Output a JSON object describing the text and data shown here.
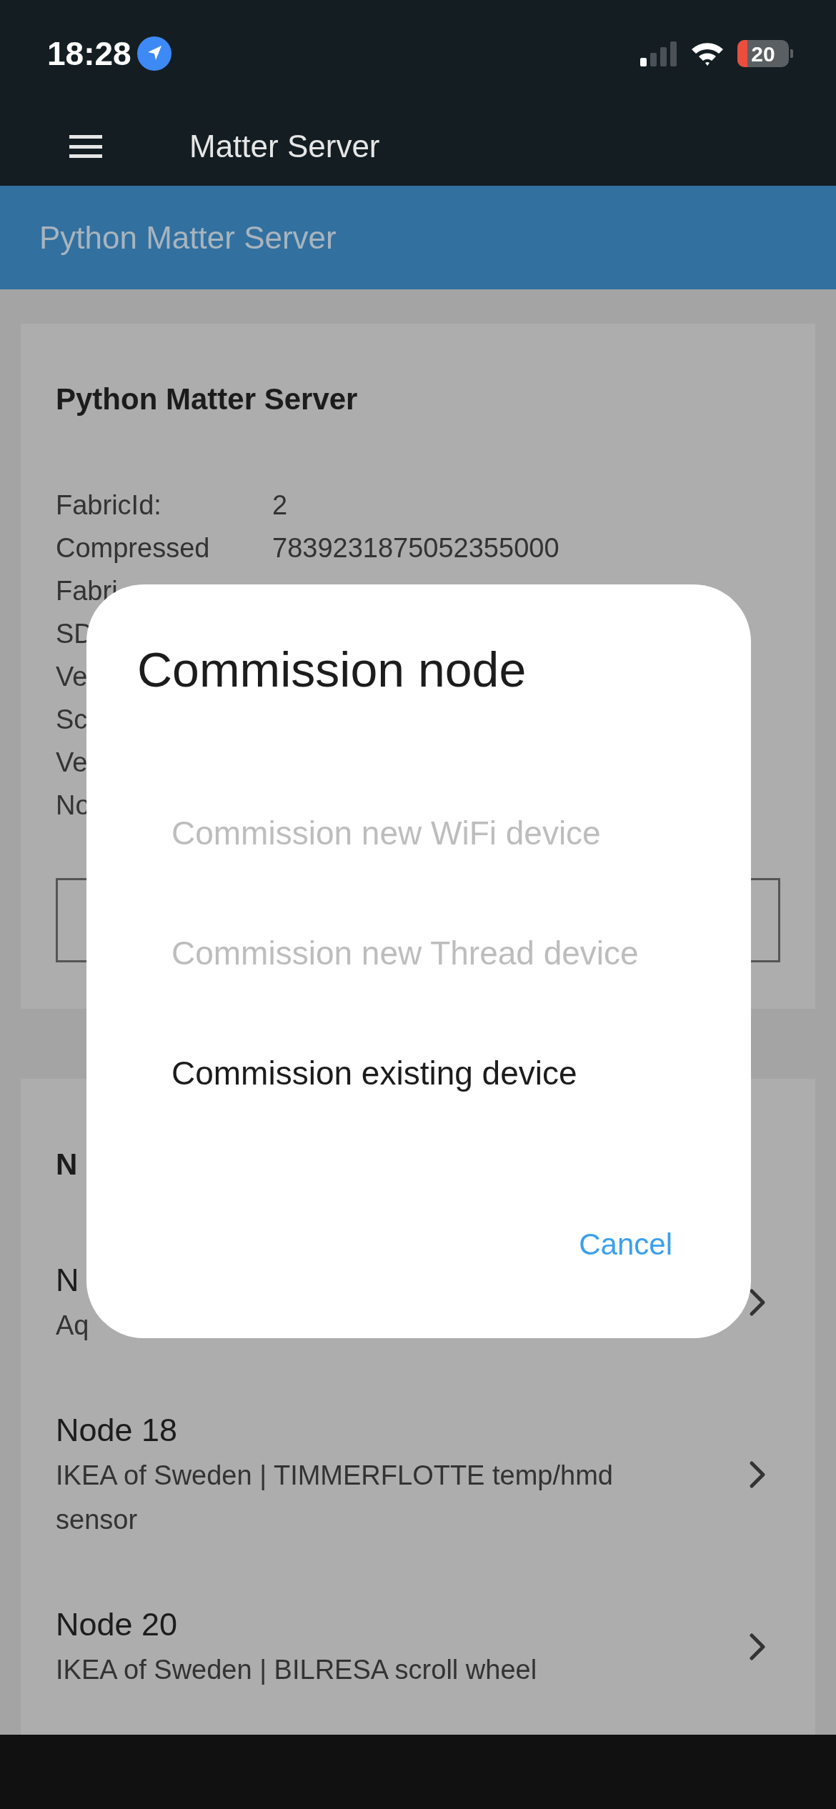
{
  "status_bar": {
    "time": "18:28",
    "battery": "20"
  },
  "app_bar": {
    "title": "Matter Server"
  },
  "banner": {
    "title": "Python Matter Server"
  },
  "server_card": {
    "title": "Python Matter Server",
    "rows": [
      {
        "label": "FabricId:",
        "value": "2"
      },
      {
        "label": "Compressed",
        "value": "7839231875052355000"
      },
      {
        "label": "Fabri"
      },
      {
        "label": "SD"
      },
      {
        "label": "Ve"
      },
      {
        "label": "Sc"
      },
      {
        "label": "Ve"
      },
      {
        "label": "No"
      }
    ]
  },
  "nodes_card": {
    "title": "N",
    "nodes": [
      {
        "title": "N",
        "subtitle": "Aq"
      },
      {
        "title": "Node 18",
        "subtitle": "IKEA of Sweden | TIMMERFLOTTE temp/hmd sensor"
      },
      {
        "title": "Node 20",
        "subtitle": "IKEA of Sweden | BILRESA scroll wheel"
      }
    ]
  },
  "dialog": {
    "title": "Commission node",
    "options": [
      {
        "label": "Commission new WiFi device",
        "disabled": true
      },
      {
        "label": "Commission new Thread device",
        "disabled": true
      },
      {
        "label": "Commission existing device",
        "disabled": false
      }
    ],
    "cancel": "Cancel"
  }
}
